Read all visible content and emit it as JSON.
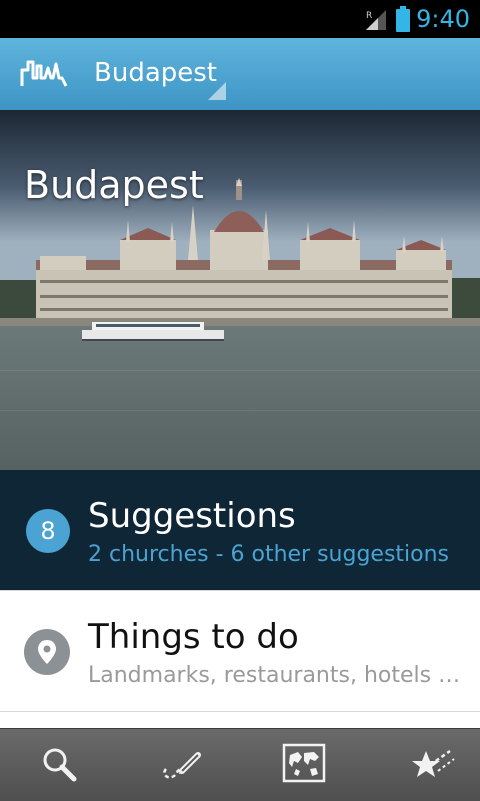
{
  "status_bar": {
    "signal_label": "R",
    "time": "9:40",
    "accent": "#33b5e5"
  },
  "action_bar": {
    "logo_icon": "city-skyline-icon",
    "city": "Budapest",
    "color": "#4aa6d4"
  },
  "hero": {
    "title": "Budapest",
    "image": "hungarian-parliament-on-danube"
  },
  "suggestions": {
    "count": "8",
    "title": "Suggestions",
    "subtitle": "2 churches - 6 other suggestions"
  },
  "things_to_do": {
    "icon": "map-pin-icon",
    "title": "Things to do",
    "subtitle": "Landmarks, restaurants, hotels …"
  },
  "bottom_tabs": [
    {
      "icon": "search-icon"
    },
    {
      "icon": "trip-pencil-icon"
    },
    {
      "icon": "world-map-icon"
    },
    {
      "icon": "starred-places-icon"
    }
  ]
}
